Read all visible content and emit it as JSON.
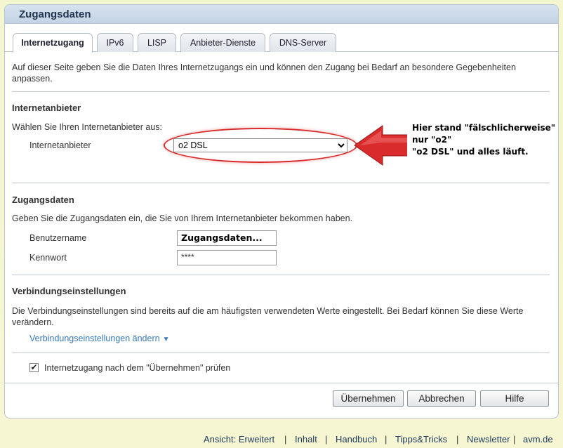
{
  "header": {
    "title": "Zugangsdaten"
  },
  "tabs": [
    {
      "label": "Internetzugang",
      "active": true
    },
    {
      "label": "IPv6"
    },
    {
      "label": "LISP"
    },
    {
      "label": "Anbieter-Dienste"
    },
    {
      "label": "DNS-Server"
    }
  ],
  "intro": "Auf dieser Seite geben Sie die Daten Ihres Internetzugangs ein und können den Zugang bei Bedarf an besondere Gegebenheiten anpassen.",
  "provider_section": {
    "title": "Internetanbieter",
    "instruction": "Wählen Sie Ihren Internetanbieter aus:",
    "label": "Internetanbieter",
    "selected": "o2 DSL"
  },
  "annotation": {
    "line1": "Hier stand \"fälschlicherweise\"",
    "line2": "nur \"o2\"",
    "line3": "\"o2 DSL\" und alles läuft.",
    "color": "#d92b2b"
  },
  "credentials": {
    "title": "Zugangsdaten",
    "instruction": "Geben Sie die Zugangsdaten ein, die Sie von Ihrem Internetanbieter bekommen haben.",
    "username_label": "Benutzername",
    "username_value": "Zugangsdaten...",
    "password_label": "Kennwort",
    "password_value": "****"
  },
  "connection": {
    "title": "Verbindungseinstellungen",
    "description": "Die Verbindungseinstellungen sind bereits auf die am häufigsten verwendeten Werte eingestellt. Bei Bedarf können Sie diese Werte verändern.",
    "link": "Verbindungseinstellungen ändern",
    "link_icon": "triangle-down-icon"
  },
  "check": {
    "label": "Internetzugang nach dem \"Übernehmen\" prüfen",
    "checked": true
  },
  "buttons": {
    "apply": "Übernehmen",
    "cancel": "Abbrechen",
    "help": "Hilfe"
  },
  "footer": {
    "view": "Ansicht: Erweitert",
    "content": "Inhalt",
    "manual": "Handbuch",
    "tips": "Tipps&Tricks",
    "newsletter": "Newsletter",
    "avm": "avm.de",
    "separator": "|"
  }
}
